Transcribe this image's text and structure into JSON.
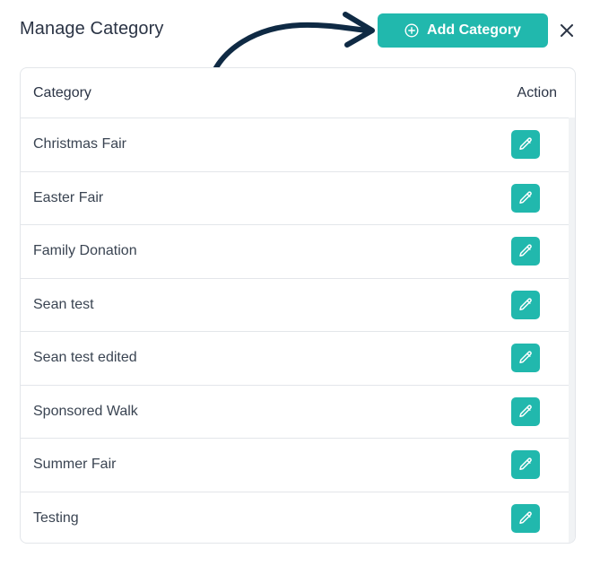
{
  "header": {
    "title": "Manage Category",
    "add_button_label": "Add Category",
    "add_icon": "plus-circle-icon",
    "close_icon": "close-icon"
  },
  "table": {
    "columns": [
      "Category",
      "Action"
    ],
    "rows": [
      {
        "name": "Christmas Fair",
        "action_icon": "pencil-icon"
      },
      {
        "name": "Easter Fair",
        "action_icon": "pencil-icon"
      },
      {
        "name": "Family Donation",
        "action_icon": "pencil-icon"
      },
      {
        "name": "Sean test",
        "action_icon": "pencil-icon"
      },
      {
        "name": "Sean test edited",
        "action_icon": "pencil-icon"
      },
      {
        "name": "Sponsored Walk",
        "action_icon": "pencil-icon"
      },
      {
        "name": "Summer Fair",
        "action_icon": "pencil-icon"
      },
      {
        "name": "Testing",
        "action_icon": "pencil-icon"
      }
    ]
  },
  "colors": {
    "accent": "#21b8ad",
    "annotation_arrow": "#0f2a44"
  }
}
